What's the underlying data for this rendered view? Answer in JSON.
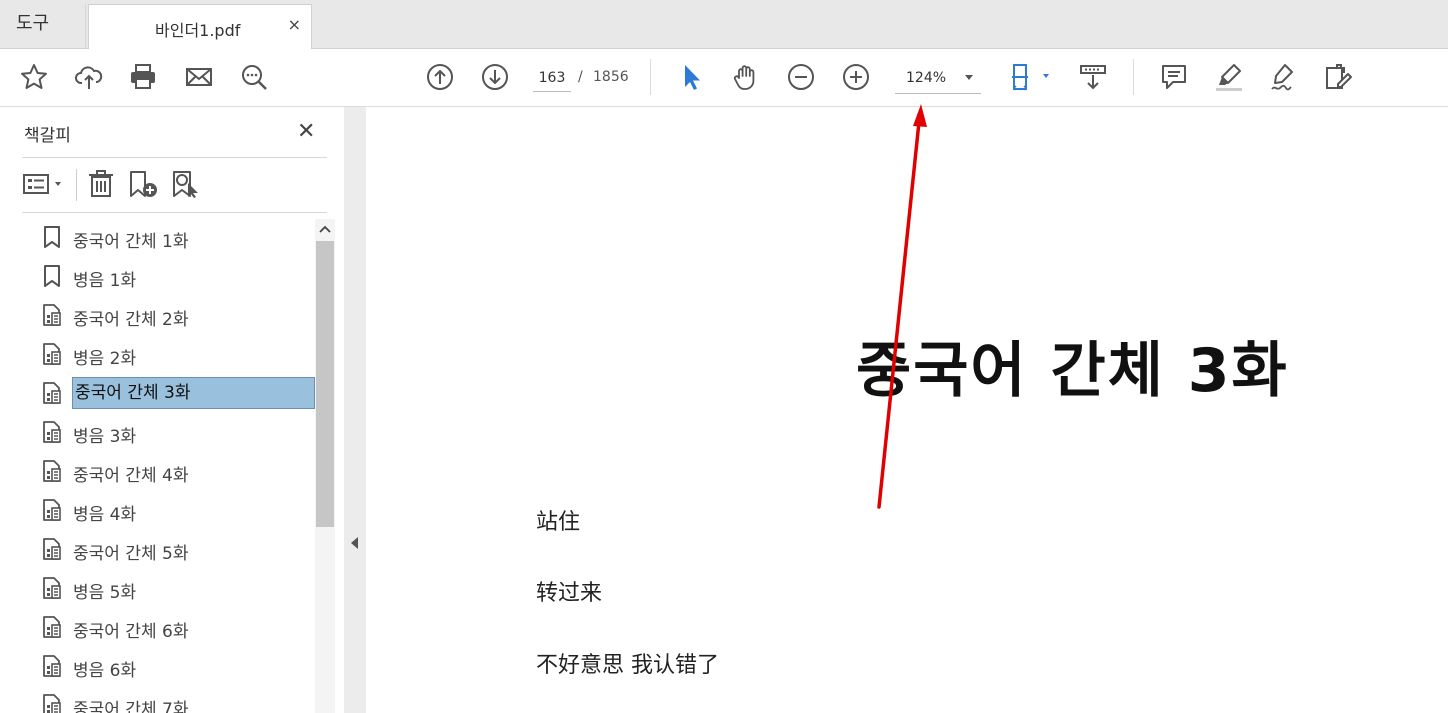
{
  "tabs": {
    "tools_label": "도구",
    "doc_label": "바인더1.pdf",
    "close_glyph": "×"
  },
  "toolbar": {
    "page_current": "163",
    "page_separator": "/",
    "page_total": "1856",
    "zoom": "124%",
    "icons_left": [
      "star-icon",
      "cloud-upload-icon",
      "print-icon",
      "email-icon",
      "search-zoom-icon"
    ],
    "icons_nav": [
      "page-up-icon",
      "page-down-icon"
    ],
    "icons_tools": [
      "select-cursor-icon",
      "hand-icon",
      "zoom-out-icon",
      "zoom-in-icon"
    ],
    "icons_right": [
      "fit-page-icon",
      "scroll-mode-icon",
      "comment-icon",
      "highlight-icon",
      "sign-icon",
      "edit-pdf-icon"
    ],
    "accent_color": "#2d7bd6"
  },
  "sidebar": {
    "title": "책갈피",
    "close_glyph": "✕",
    "bookmarks": [
      {
        "label": "중국어 간체 1화",
        "icon": "bookmark-icon"
      },
      {
        "label": "병음 1화",
        "icon": "bookmark-icon"
      },
      {
        "label": "중국어 간체 2화",
        "icon": "document-bookmark-icon"
      },
      {
        "label": "병음 2화",
        "icon": "document-bookmark-icon"
      },
      {
        "label": "중국어 간체 3화",
        "icon": "document-bookmark-icon",
        "selected": true
      },
      {
        "label": "병음 3화",
        "icon": "document-bookmark-icon"
      },
      {
        "label": "중국어 간체 4화",
        "icon": "document-bookmark-icon"
      },
      {
        "label": "병음 4화",
        "icon": "document-bookmark-icon"
      },
      {
        "label": "중국어 간체 5화",
        "icon": "document-bookmark-icon"
      },
      {
        "label": "병음 5화",
        "icon": "document-bookmark-icon"
      },
      {
        "label": "중국어 간체 6화",
        "icon": "document-bookmark-icon"
      },
      {
        "label": "병음 6화",
        "icon": "document-bookmark-icon"
      },
      {
        "label": "중국어 간체 7화",
        "icon": "document-bookmark-icon"
      }
    ],
    "selection_color": "#99c0dc"
  },
  "document": {
    "heading": "중국어  간체  3화",
    "lines": [
      "站住",
      "转过来",
      "不好意思  我认错了"
    ]
  },
  "annotation": {
    "arrow_color": "#e00000"
  }
}
